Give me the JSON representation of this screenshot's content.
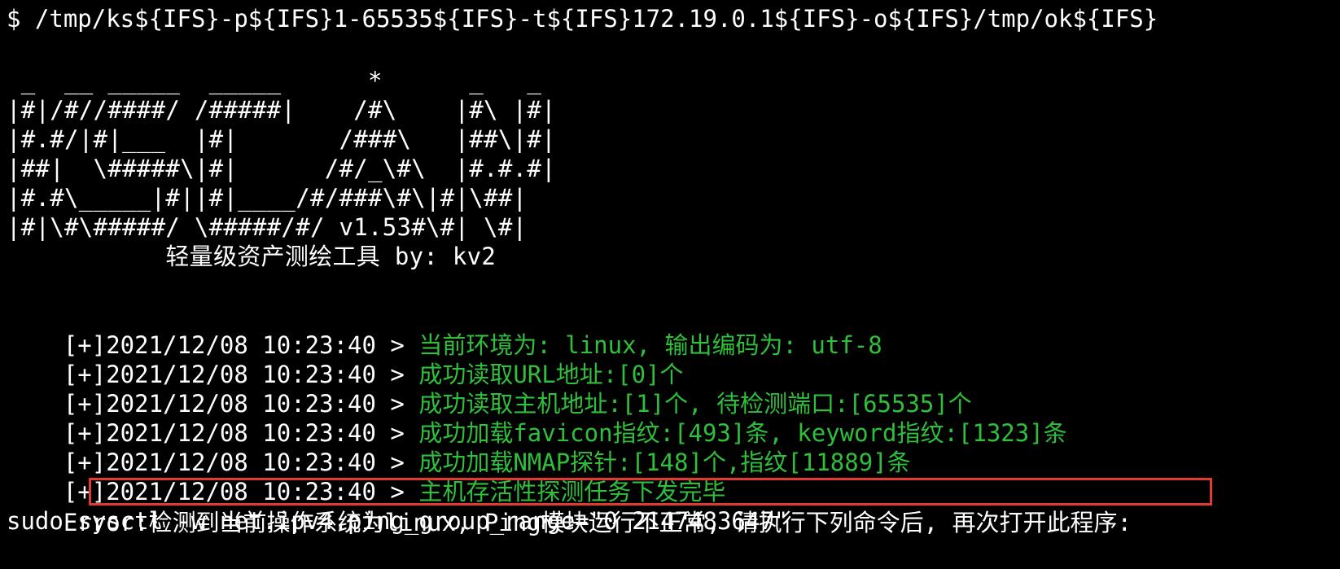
{
  "command": "$ /tmp/ks${IFS}-p${IFS}1-65535${IFS}-t${IFS}172.19.0.1${IFS}-o${IFS}/tmp/ok${IFS}",
  "banner": {
    "lines": [
      " _  __ _____  _____      *      _   _ ",
      "|#|/#//####/ /#####|    /#\\    |#\\ |#|",
      "|#.#/|#|___  |#|       /###\\   |##\\|#|",
      "|##|  \\#####\\|#|      /#/_\\#\\  |#.#.#|",
      "|#.#\\_____|#||#|____/#/###\\#\\|#|\\##|",
      "|#|\\#\\#####/ \\#####/#/ v1.53#\\#| \\#|"
    ],
    "subtitle": "           轻量级资产测绘工具 by: kv2"
  },
  "log": [
    {
      "prefix": "[+]2021/12/08 10:23:40 > ",
      "message": "当前环境为: linux, 输出编码为: utf-8"
    },
    {
      "prefix": "[+]2021/12/08 10:23:40 > ",
      "message": "成功读取URL地址:[0]个"
    },
    {
      "prefix": "[+]2021/12/08 10:23:40 > ",
      "message": "成功读取主机地址:[1]个, 待检测端口:[65535]个"
    },
    {
      "prefix": "[+]2021/12/08 10:23:40 > ",
      "message": "成功加载favicon指纹:[493]条, keyword指纹:[1323]条"
    },
    {
      "prefix": "[+]2021/12/08 10:23:40 > ",
      "message": "成功加载NMAP探针:[148]个,指纹[11889]条"
    },
    {
      "prefix": "[+]2021/12/08 10:23:40 > ",
      "message": "主机存活性探测任务下发完毕"
    }
  ],
  "error": {
    "label": "Error:",
    "message": "检测到当前操作系统为linux, Ping模块运行不正常, 请执行下列命令后, 再次打开此程序:"
  },
  "fix_command": "sudo sysctl -w net.ipv4.ping_group_range=\"0 2147483647\"",
  "colors": {
    "background": "#000000",
    "text": "#ffffff",
    "success": "#2fbf3a",
    "highlight_border": "#e23a33"
  }
}
